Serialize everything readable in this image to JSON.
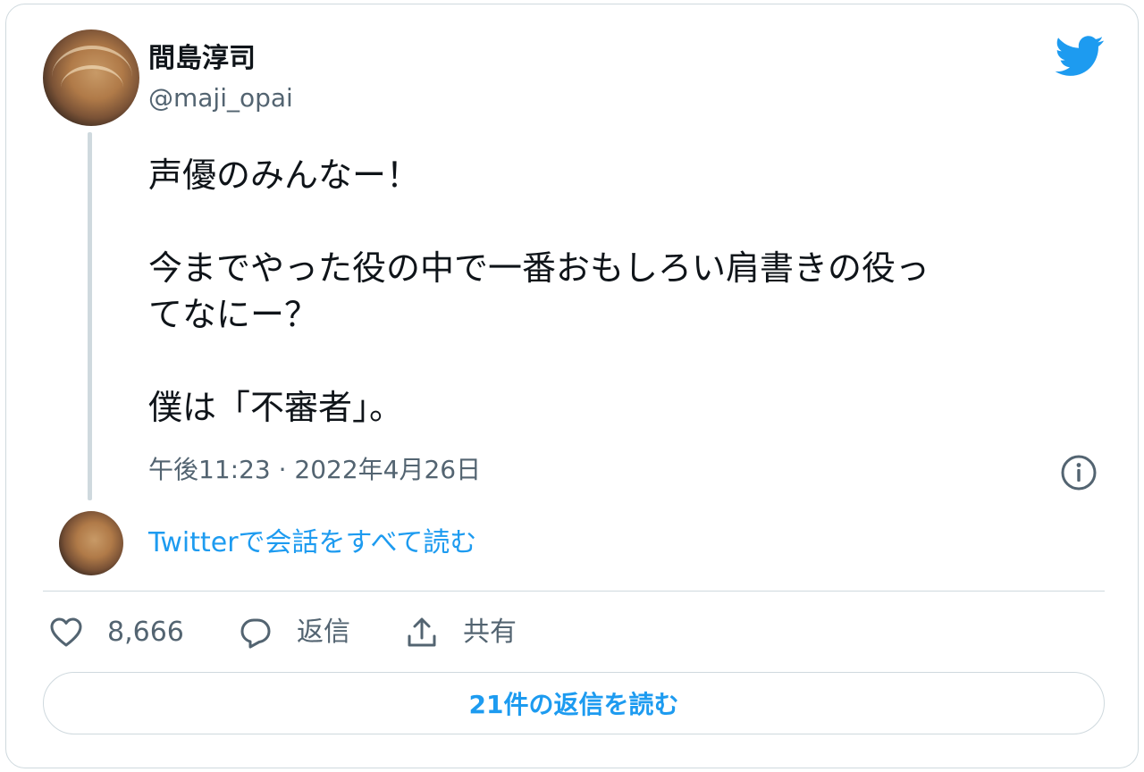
{
  "author": {
    "name": "間島淳司",
    "handle": "@maji_opai"
  },
  "tweet": {
    "lines": [
      "声優のみんなー！",
      "",
      "今までやった役の中で一番おもしろい肩書きの役っ",
      "てなにー？",
      "",
      "僕は「不審者」。"
    ],
    "timestamp": "午後11:23 · 2022年4月26日"
  },
  "conversation_link": "Twitterで会話をすべて読む",
  "actions": {
    "like_count": "8,666",
    "reply_label": "返信",
    "share_label": "共有"
  },
  "replies_button": "21件の返信を読む",
  "colors": {
    "accent": "#1d9bf0",
    "text": "#0f1419",
    "muted": "#536471",
    "border": "#cfd9de"
  },
  "icons": [
    "twitter-bird-icon",
    "info-icon",
    "heart-icon",
    "reply-bubble-icon",
    "share-icon"
  ]
}
